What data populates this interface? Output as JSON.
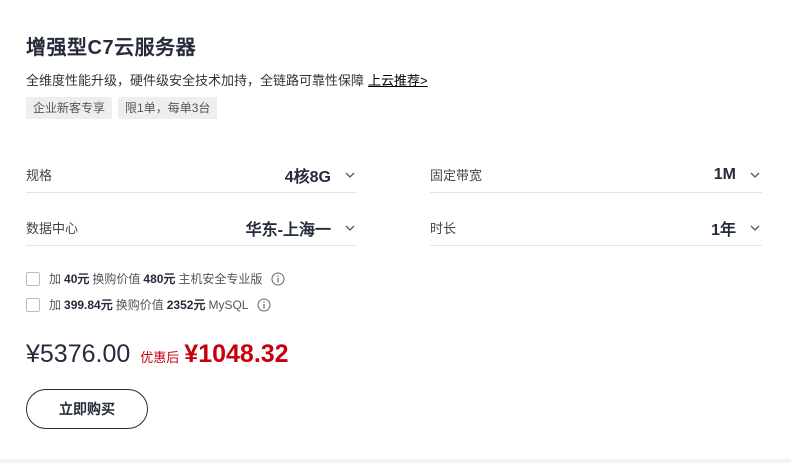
{
  "product": {
    "title": "增强型C7云服务器",
    "subtitle": "全维度性能升级，硬件级安全技术加持，全链路可靠性保障",
    "subtitle_link": "上云推荐>",
    "tags": [
      "企业新客专享",
      "限1单，每单3台"
    ]
  },
  "config": {
    "spec": {
      "label": "规格",
      "value": "4核8G"
    },
    "bandwidth": {
      "label": "固定带宽",
      "value": "1M"
    },
    "datacenter": {
      "label": "数据中心",
      "value": "华东-上海一"
    },
    "duration": {
      "label": "时长",
      "value": "1年"
    }
  },
  "addons": [
    {
      "prefix": "加",
      "price": "40元",
      "mid": "换购价值",
      "value": "480元",
      "name": "主机安全专业版"
    },
    {
      "prefix": "加",
      "price": "399.84元",
      "mid": "换购价值",
      "value": "2352元",
      "name": "MySQL"
    }
  ],
  "pricing": {
    "original": "¥5376.00",
    "after_label": "优惠后",
    "final": "¥1048.32"
  },
  "buy_button": "立即购买",
  "icons": {
    "dropdown": "chevron-down-icon",
    "info": "info-icon"
  },
  "colors": {
    "accent": "#c7000b",
    "text": "#252b3a"
  }
}
